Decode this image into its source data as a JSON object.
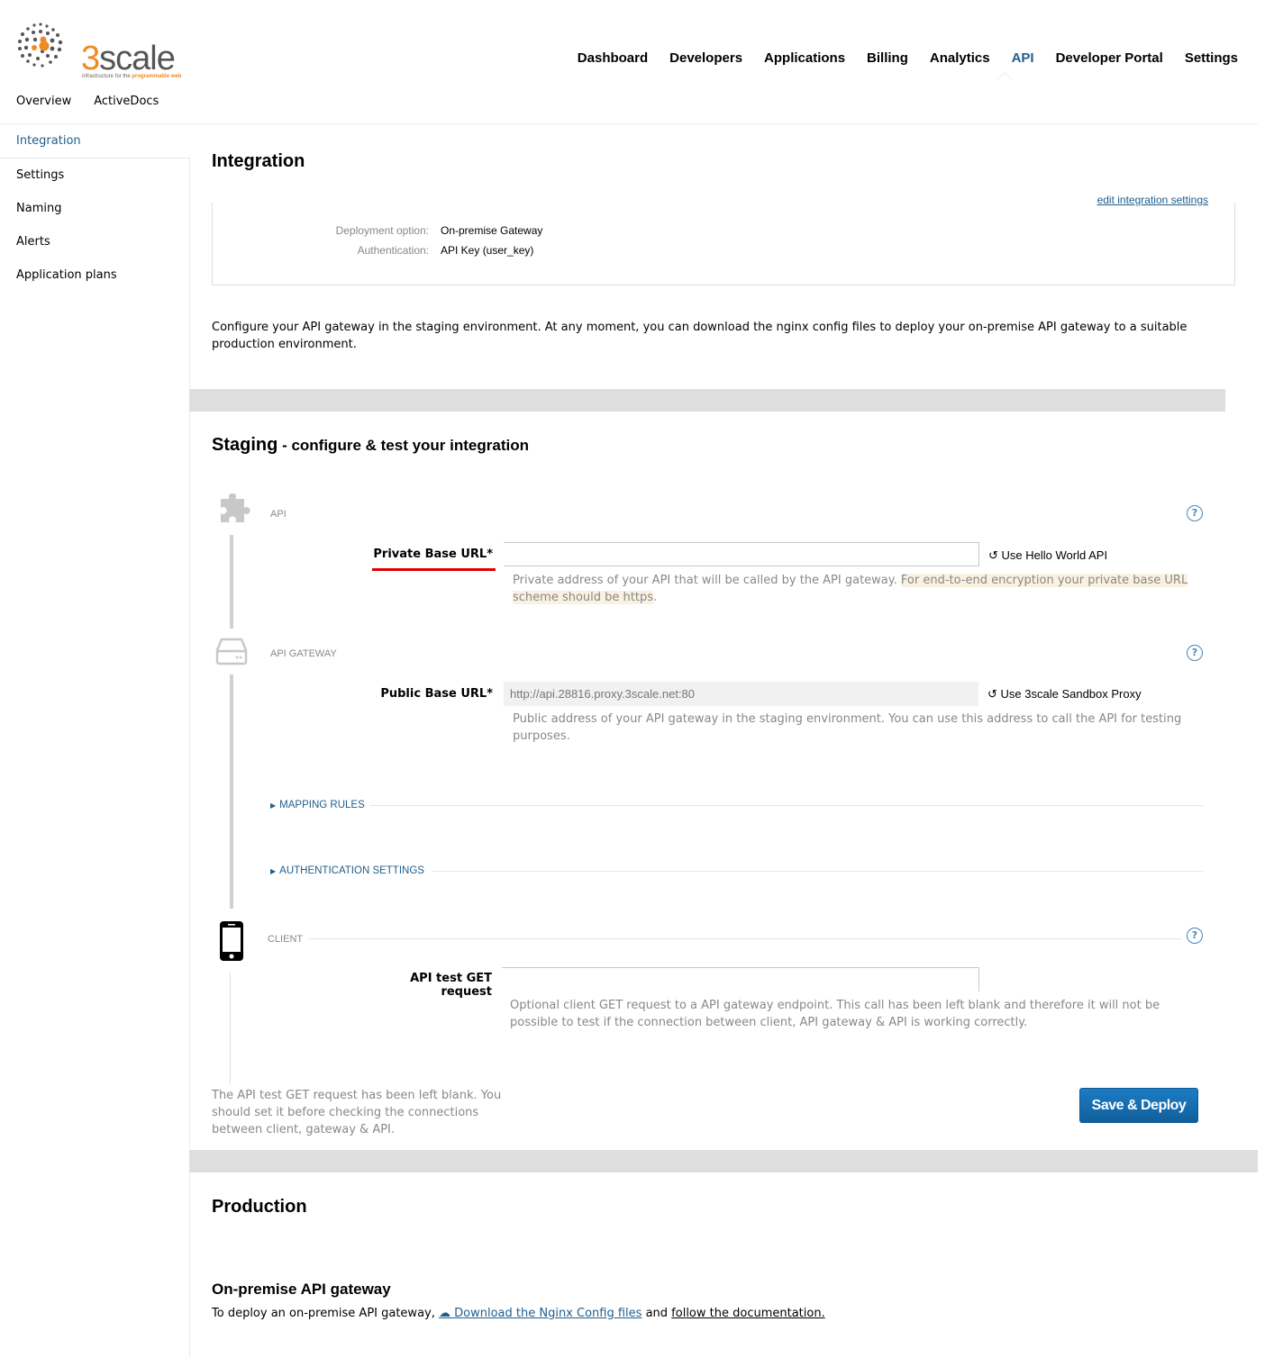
{
  "brand": {
    "name_prefix": "3",
    "name_rest": "scale",
    "tagline_start": "infrastructure for the ",
    "tagline_highlight": "programmable web",
    "accent_color": "#f08a24"
  },
  "topnav": {
    "items": [
      {
        "label": "Dashboard"
      },
      {
        "label": "Developers"
      },
      {
        "label": "Applications"
      },
      {
        "label": "Billing"
      },
      {
        "label": "Analytics"
      },
      {
        "label": "API",
        "active": true
      },
      {
        "label": "Developer Portal"
      },
      {
        "label": "Settings"
      }
    ]
  },
  "subnav": {
    "items": [
      {
        "label": "Overview"
      },
      {
        "label": "ActiveDocs"
      }
    ]
  },
  "sidebar": {
    "items": [
      {
        "label": "Integration",
        "active": true
      },
      {
        "label": "Settings"
      },
      {
        "label": "Naming"
      },
      {
        "label": "Alerts"
      },
      {
        "label": "Application plans"
      }
    ]
  },
  "integration": {
    "title": "Integration",
    "edit_link": "edit integration settings",
    "deployment_label": "Deployment option:",
    "deployment_value": "On-premise Gateway",
    "auth_label": "Authentication:",
    "auth_value": "API Key (user_key)",
    "intro": "Configure your API gateway in the staging environment. At any moment, you can download the nginx config files to deploy your on-premise API gateway to a suitable production environment."
  },
  "staging": {
    "title": "Staging",
    "subtitle": " - configure & test your integration",
    "api_step": {
      "label": "API",
      "field_label": "Private Base URL*",
      "value": "",
      "use_link": "Use Hello World API",
      "hint": "Private address of your API that will be called by the API gateway. ",
      "hint_highlight": "For end-to-end encryption your private base URL scheme should be https",
      "hint_end": "."
    },
    "gateway_step": {
      "label": "API GATEWAY",
      "field_label": "Public Base URL*",
      "value": "http://api.28816.proxy.3scale.net:80",
      "use_link": "Use 3scale Sandbox Proxy",
      "hint": "Public address of your API gateway in the staging environment. You can use this address to call the API for testing purposes."
    },
    "mapping_rules": "MAPPING RULES",
    "auth_settings": "AUTHENTICATION SETTINGS",
    "client_step": {
      "label": "CLIENT",
      "field_label": "API test GET request",
      "value": "",
      "hint": "Optional client GET request to a API gateway endpoint. This call has been left blank and therefore it will not be possible to test if the connection between client, API gateway & API is working correctly."
    },
    "warning": "The API test GET request has been left blank. You should set it before checking the connections between client, gateway & API.",
    "save_button": "Save & Deploy"
  },
  "production": {
    "title": "Production",
    "subtitle": "On-premise API gateway",
    "text_start": "To deploy an on-premise API gateway, ",
    "download_link": "Download the Nginx Config files",
    "text_mid": " and ",
    "doc_link": "follow the documentation."
  },
  "icons": {
    "api": "puzzle-icon",
    "gateway": "server-icon",
    "client": "smartphone-icon",
    "help": "help-icon",
    "reset": "undo-icon",
    "download": "cloud-download-icon",
    "expand": "triangle-right-icon"
  },
  "colors": {
    "link": "#1f5e8e",
    "required_underline": "#e00000",
    "button": "#1670b4",
    "band": "#dedede"
  }
}
